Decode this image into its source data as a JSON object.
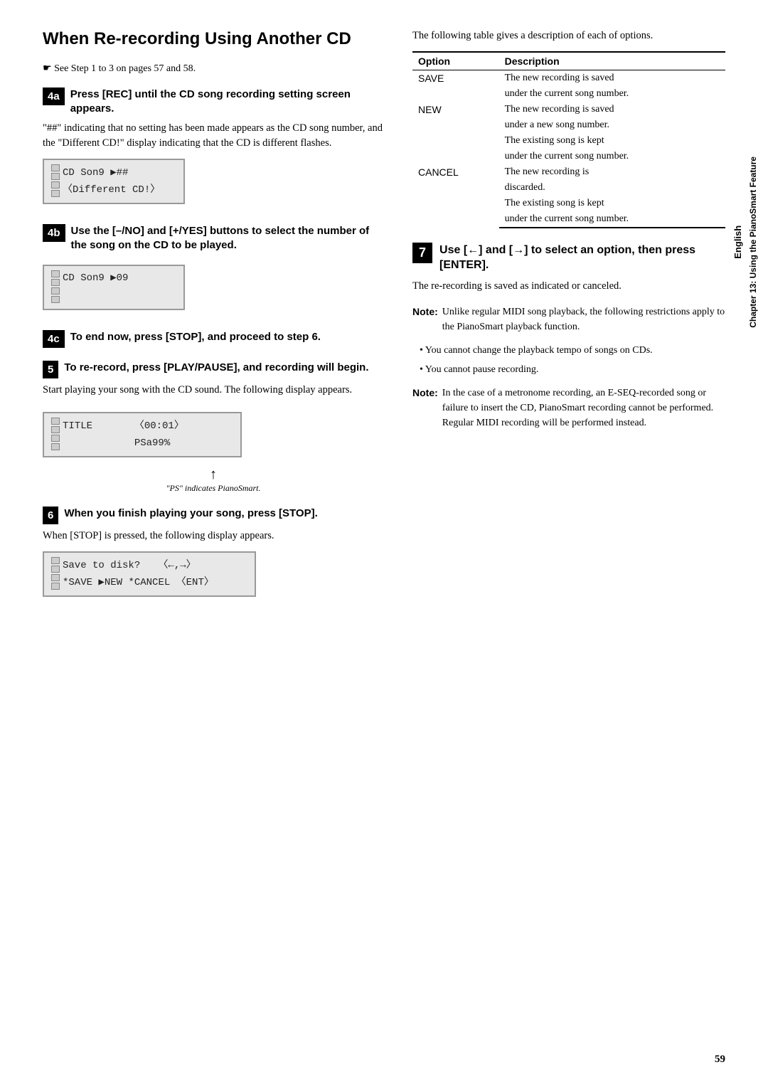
{
  "page": {
    "title": "When Re-recording Using Another CD",
    "page_number": "59",
    "sidebar": {
      "language": "English",
      "chapter": "Chapter 13: Using the PianoSmart Feature"
    }
  },
  "left_col": {
    "see_step": "See Step 1 to 3 on pages 57 and 58.",
    "steps": [
      {
        "id": "4a",
        "title": "Press [REC] until the CD song recording setting screen appears.",
        "body": "\"##\" indicating that no setting has been made appears as the CD song number, and the \"Different CD!\" display indicating that the CD is different flashes.",
        "lcd": {
          "row1_squares": true,
          "row1_text": "CD Son9 ▶##",
          "row2_squares": true,
          "row2_text": "〈Different CD!〉"
        }
      },
      {
        "id": "4b",
        "title": "Use the [–/NO] and [+/YES] buttons to select the number of the song on the CD to be played.",
        "lcd": {
          "row1_squares": true,
          "row1_text": "CD Son9 ▶09",
          "row2_squares": true,
          "row2_text": ""
        }
      },
      {
        "id": "4c",
        "title": "To end now, press [STOP], and proceed to step 6."
      },
      {
        "id": "5",
        "title": "To re-record, press [PLAY/PAUSE], and recording will begin.",
        "body": "Start playing your song with the CD sound. The following display appears.",
        "lcd": {
          "row1_squares": true,
          "row1_text": "TITLE       〈00:01〉",
          "row2_squares": true,
          "row2_text": "            PSa99%"
        },
        "caption": "\"PS\" indicates PianoSmart."
      }
    ],
    "step6": {
      "id": "6",
      "title": "When you finish playing your song, press [STOP].",
      "body": "When [STOP] is pressed, the following display appears.",
      "lcd": {
        "row1_squares": true,
        "row1_text": "Save to disk?    〈←,→〉",
        "row2_squares": true,
        "row2_text": "*SAVE ▶NEW *CANCEL 〈ENT〉"
      }
    }
  },
  "right_col": {
    "table_intro": "The following table gives a description of each of options.",
    "table": {
      "headers": [
        "Option",
        "Description"
      ],
      "rows": [
        {
          "option": "SAVE",
          "description_lines": [
            "The new recording is saved",
            "under the current song number."
          ]
        },
        {
          "option": "NEW",
          "description_lines": [
            "The new recording is saved",
            "under a new song number.",
            "The existing song is kept",
            "under the current song number."
          ]
        },
        {
          "option": "CANCEL",
          "description_lines": [
            "The new recording is",
            "discarded.",
            "The existing song is kept",
            "under the current song number."
          ]
        }
      ]
    },
    "step7": {
      "id": "7",
      "title": "Use [←] and [→] to select an option, then press [ENTER].",
      "body": "The re-recording is saved as indicated or canceled."
    },
    "notes": [
      {
        "label": "Note:",
        "text": "Unlike regular MIDI song playback, the following restrictions apply to the PianoSmart playback function."
      }
    ],
    "bullets": [
      "You cannot change the playback tempo of songs on CDs.",
      "You cannot pause recording."
    ],
    "note2": {
      "label": "Note:",
      "text": "In the case of a metronome recording, an E-SEQ-recorded song or failure to insert the CD, PianoSmart recording cannot be performed.  Regular MIDI recording will be performed instead."
    }
  }
}
